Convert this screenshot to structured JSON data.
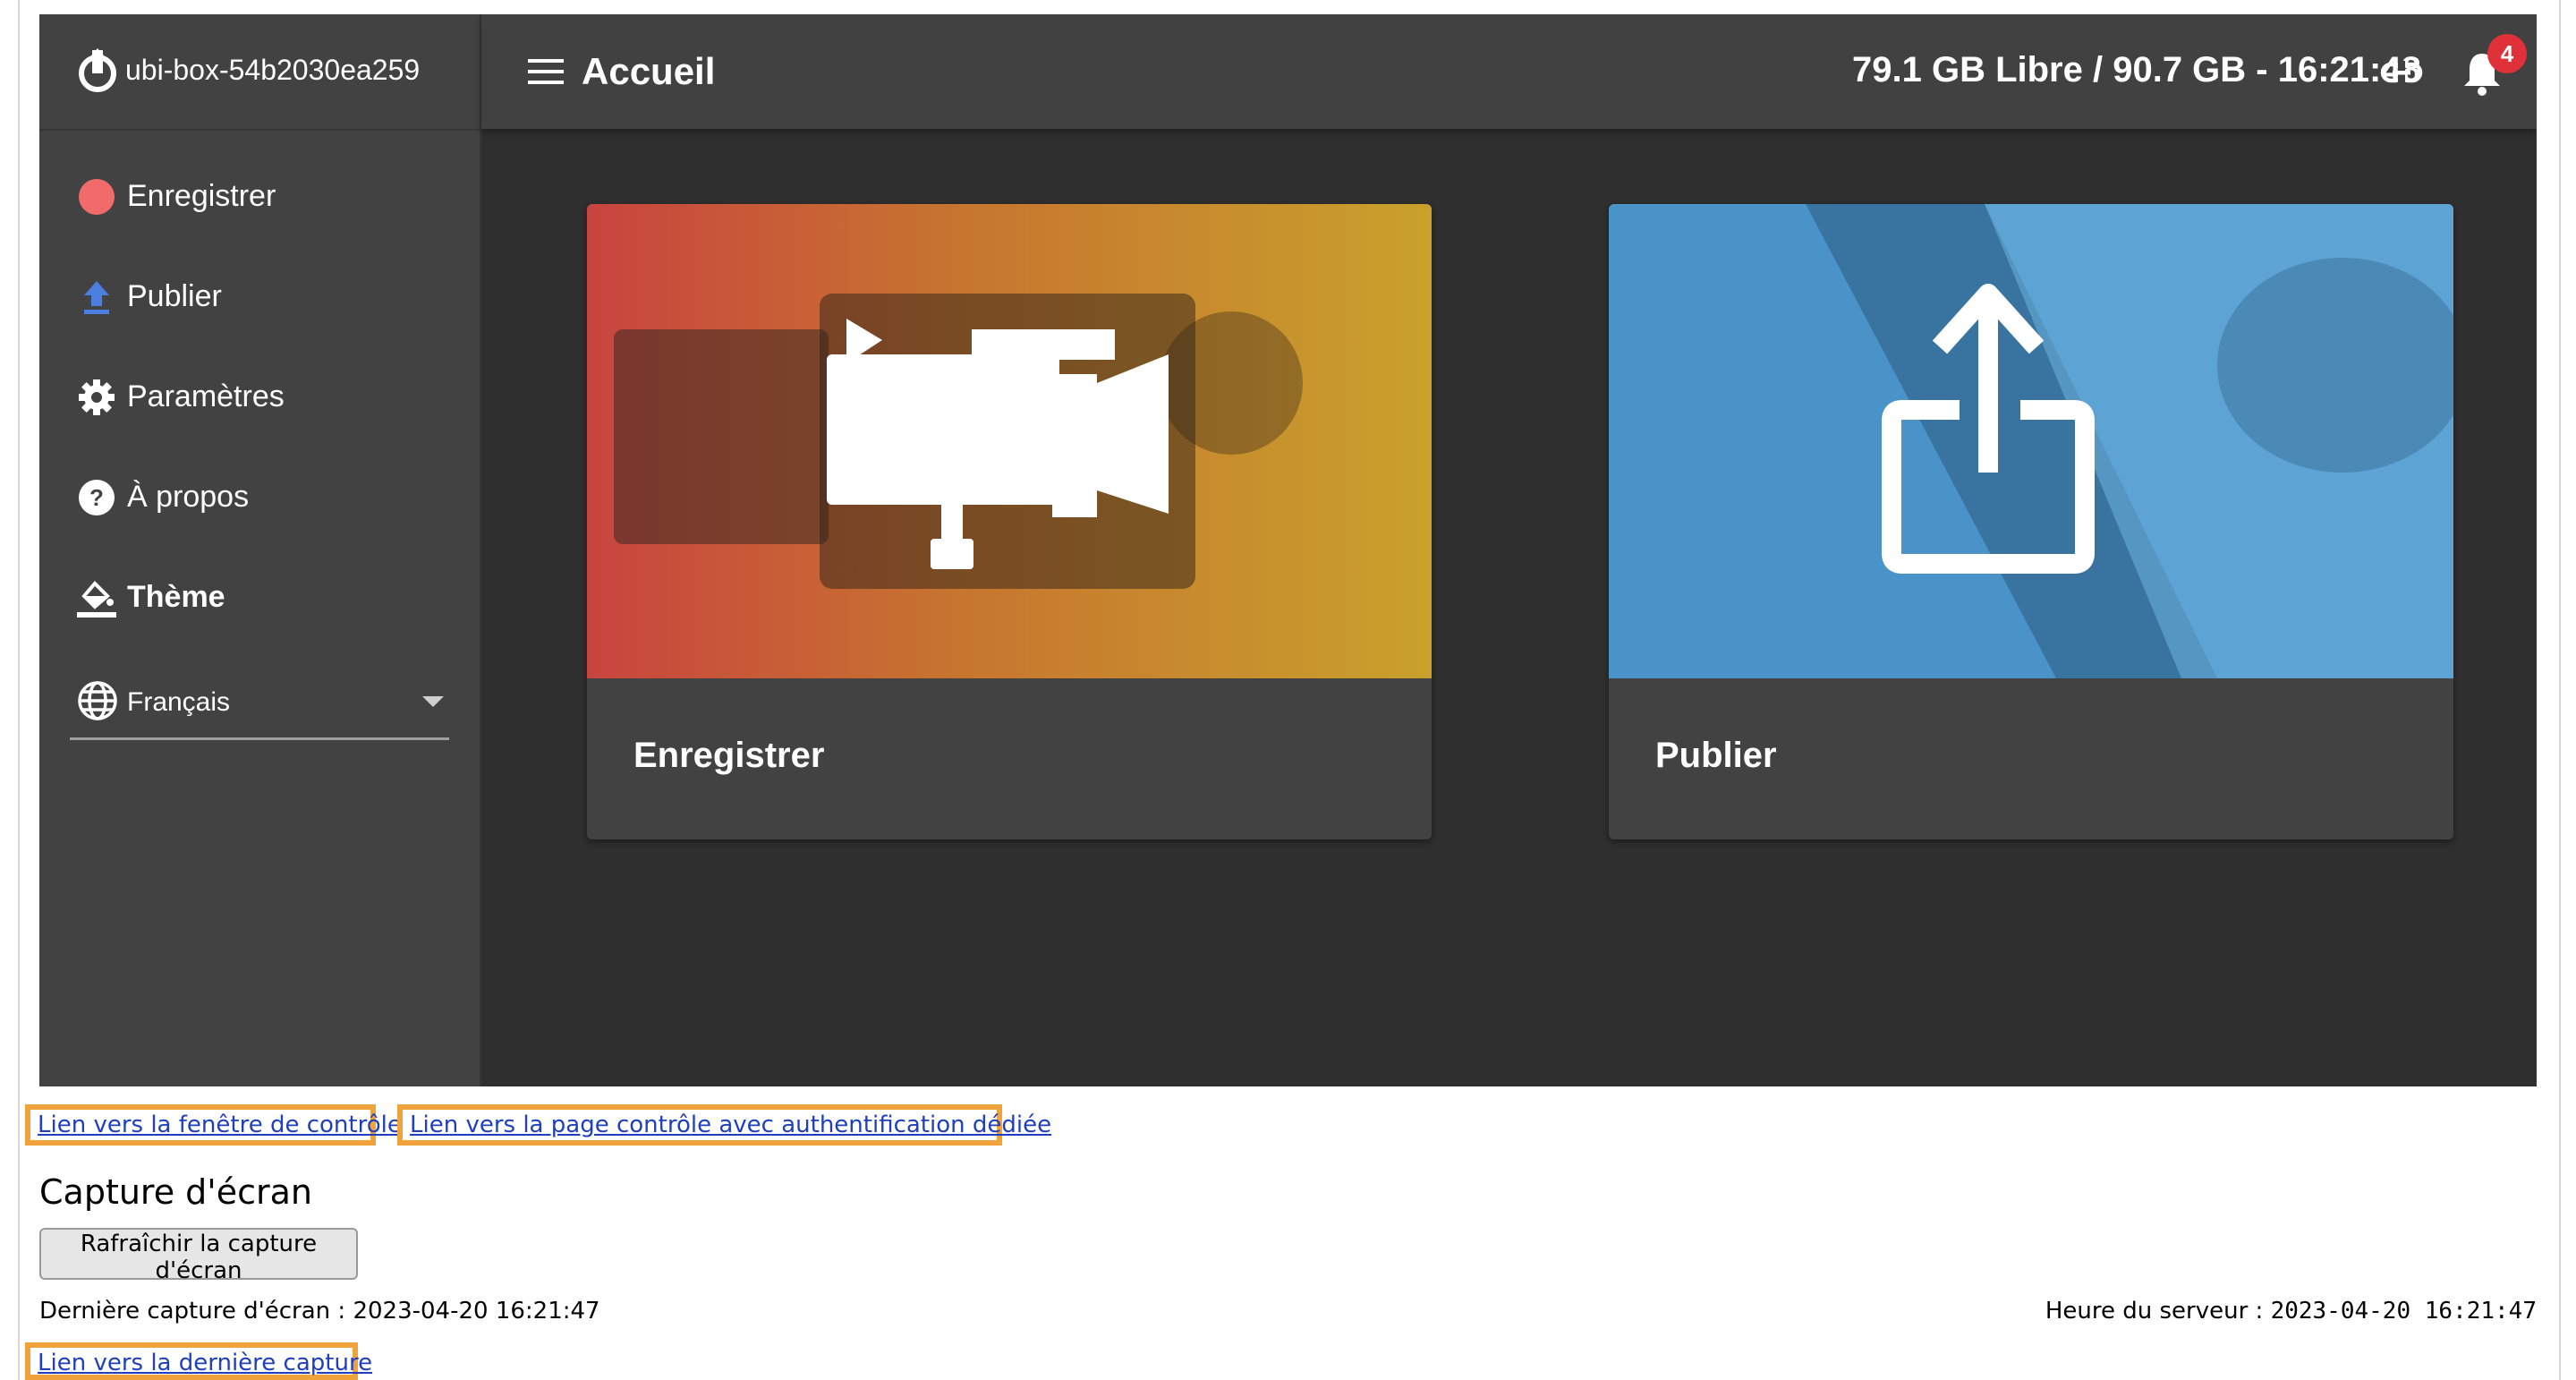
{
  "app": {
    "device_name": "ubi-box-54b2030ea259",
    "page_title": "Accueil",
    "status": "79.1 GB Libre / 90.7 GB - 16:21:48",
    "notification_count": "4",
    "colors": {
      "sidebar": "#424242",
      "content": "#2f2f2f",
      "badge": "#e0313b",
      "record_dot": "#f26b6b",
      "publish_arrow": "#4a7fe0"
    }
  },
  "sidebar": {
    "items": [
      {
        "label": "Enregistrer",
        "icon": "record-dot-icon"
      },
      {
        "label": "Publier",
        "icon": "upload-arrow-icon"
      },
      {
        "label": "Paramètres",
        "icon": "gear-icon"
      },
      {
        "label": "À propos",
        "icon": "help-circle-icon"
      },
      {
        "label": "Thème",
        "icon": "paint-bucket-icon"
      }
    ],
    "language": {
      "selected": "Français",
      "icon": "globe-icon"
    }
  },
  "cards": [
    {
      "title": "Enregistrer",
      "icon": "video-camera-icon"
    },
    {
      "title": "Publier",
      "icon": "share-upload-icon"
    }
  ],
  "footer": {
    "link_control": "Lien vers la fenêtre de contrôle",
    "link_auth": "Lien vers la page contrôle avec authentification dédiée",
    "section_title": "Capture d'écran",
    "refresh_button": "Rafraîchir la capture d'écran",
    "last_capture_label": "Dernière capture d'écran :",
    "last_capture_value": "2023-04-20 16:21:47",
    "server_time_label": "Heure du serveur :",
    "server_time_value": "2023-04-20 16:21:47",
    "link_last_capture": "Lien vers la dernière capture"
  }
}
